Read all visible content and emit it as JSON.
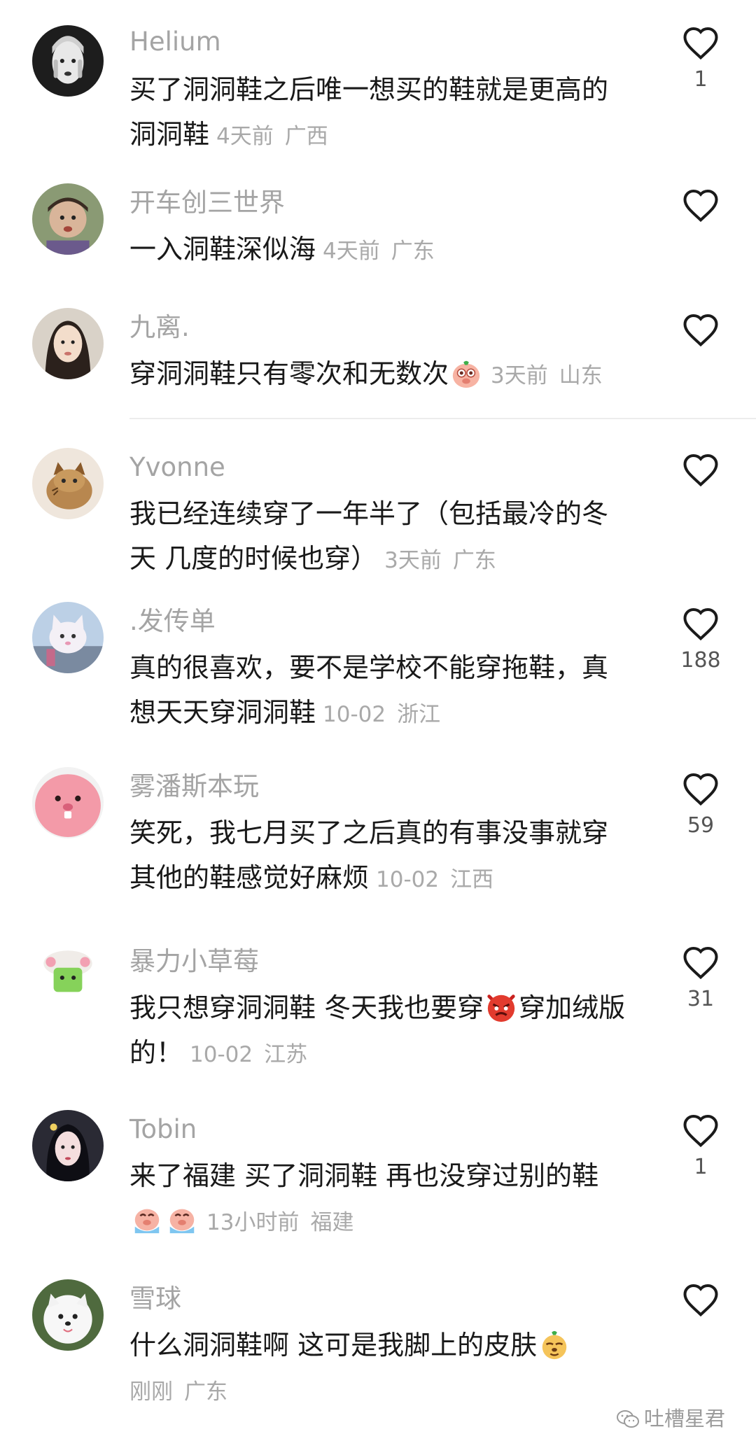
{
  "comments": [
    {
      "username": "Helium",
      "text": "买了洞洞鞋之后唯一想买的鞋就是更高的洞洞鞋",
      "time": "4天前",
      "location": "广西",
      "likes": "1"
    },
    {
      "username": "开车创三世界",
      "text": "一入洞鞋深似海",
      "time": "4天前",
      "location": "广东",
      "likes": ""
    },
    {
      "username": "九离.",
      "text": "穿洞洞鞋只有零次和无数次",
      "time": "3天前",
      "location": "山东",
      "likes": "",
      "emoji": "pig-face-emoji"
    },
    {
      "username": "Yvonne",
      "text": "我已经连续穿了一年半了（包括最冷的冬天 几度的时候也穿）",
      "time": "3天前",
      "location": "广东",
      "likes": ""
    },
    {
      "username": ".发传单",
      "text": "真的很喜欢，要不是学校不能穿拖鞋，真想天天穿洞洞鞋",
      "time": "10-02",
      "location": "浙江",
      "likes": "188"
    },
    {
      "username": "雾潘斯本玩",
      "text": "笑死，我七月买了之后真的有事没事就穿 其他的鞋感觉好麻烦",
      "time": "10-02",
      "location": "江西",
      "likes": "59"
    },
    {
      "username": "暴力小草莓",
      "text_before": "我只想穿洞洞鞋 冬天我也要穿",
      "text_after": "穿加绒版的！",
      "time": "10-02",
      "location": "江苏",
      "likes": "31",
      "emoji": "angry-devil-emoji"
    },
    {
      "username": "Tobin",
      "text": "来了福建 买了洞洞鞋 再也没穿过别的鞋",
      "time": "13小时前",
      "location": "福建",
      "likes": "1",
      "emoji": "crying-pig-emoji"
    },
    {
      "username": "雪球",
      "text": "什么洞洞鞋啊 这可是我脚上的皮肤",
      "time": "刚刚",
      "location": "广东",
      "likes": "",
      "emoji": "smug-dog-emoji"
    }
  ],
  "watermark": {
    "text": "吐槽星君",
    "icon": "wechat-icon"
  },
  "colors": {
    "username": "#a4a4a4",
    "meta": "#a9a9a9",
    "text": "#191919",
    "heart": "#1a1a1a"
  }
}
